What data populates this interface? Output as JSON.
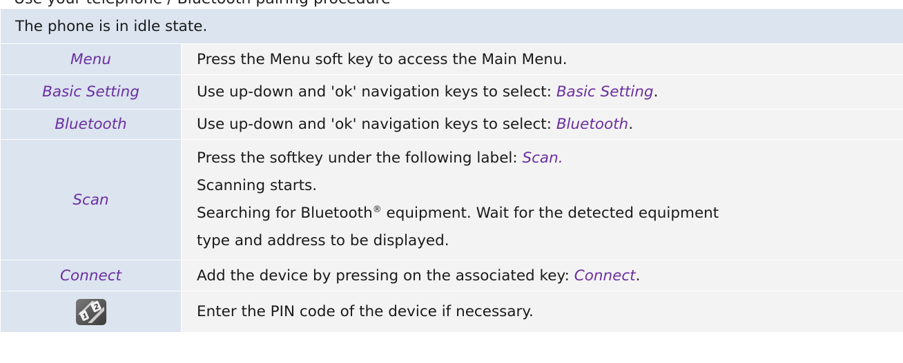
{
  "partial_top_text": "Use your telephone / Bluetooth pairing procedure",
  "header": "The phone is in idle state.",
  "steps": [
    {
      "key": "Menu",
      "desc_before": "Press the Menu soft key to access the Main Menu.",
      "desc_highlight": "",
      "desc_after": ""
    },
    {
      "key": "Basic Setting",
      "desc_before": "Use up-down and 'ok' navigation keys to select: ",
      "desc_highlight": "Basic Setting",
      "desc_after": "."
    },
    {
      "key": "Bluetooth",
      "desc_before": "Use up-down and 'ok' navigation keys to select: ",
      "desc_highlight": "Bluetooth",
      "desc_after": "."
    },
    {
      "key": "Scan",
      "line1_before": "Press the softkey under the following label: ",
      "line1_highlight": "Scan.",
      "line2": "Scanning starts.",
      "line3_before": "Searching for Bluetooth",
      "line3_sup": "®",
      "line3_after": " equipment. Wait for the detected equipment",
      "line4": "type and address to be displayed."
    },
    {
      "key": "Connect",
      "desc_before": "Add the device by pressing on the associated key: ",
      "desc_highlight": "Connect",
      "desc_after": "."
    },
    {
      "key_icon": "keypad-icon",
      "desc_before": "Enter the PIN code of the device if necessary.",
      "desc_highlight": "",
      "desc_after": ""
    }
  ],
  "colors": {
    "key_column_bg": "#dbe4ef",
    "description_bg": "#f3f3f3",
    "highlight_text": "#6b2fa0"
  }
}
